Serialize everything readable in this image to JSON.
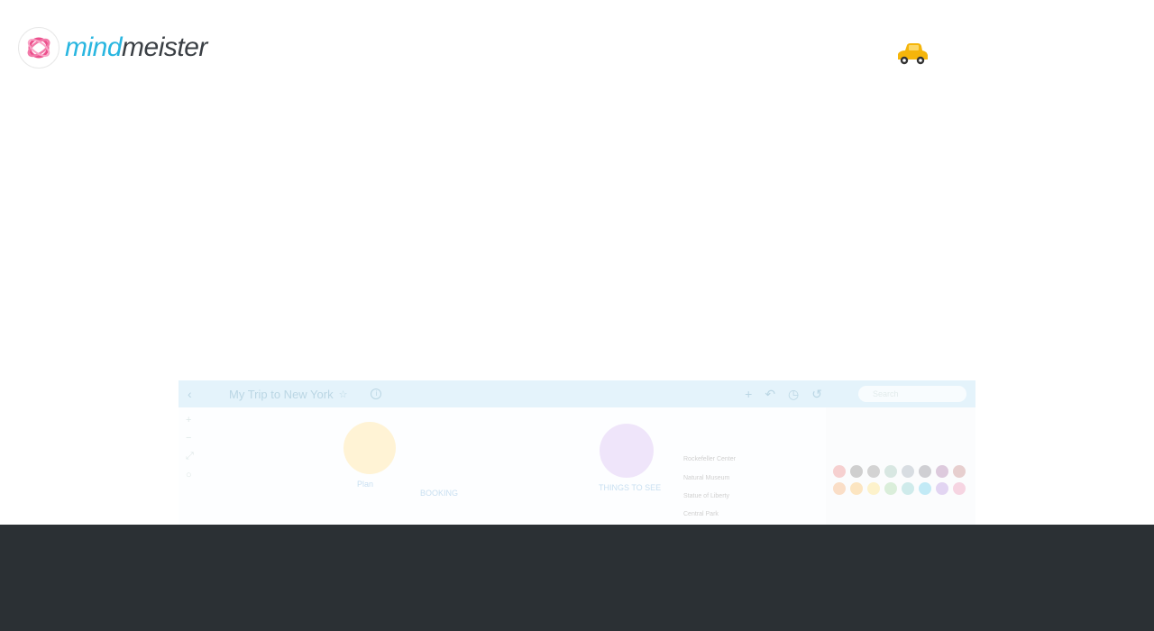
{
  "brand": {
    "name_part1": "mind",
    "name_part2": "meister"
  },
  "icons": {
    "logo": "mindmeister-logo-icon",
    "car": "taxi-car-icon"
  },
  "preview": {
    "title": "My Trip to New York",
    "star": "☆",
    "back": "‹",
    "info": "i",
    "search_placeholder": "Search",
    "tools": [
      "+",
      "↶",
      "◷",
      "↺"
    ],
    "left_tools": [
      "+",
      "−",
      "⤢",
      "○"
    ],
    "nodes": {
      "plan_label": "Plan",
      "booking_label": "BOOKING",
      "things_label": "THINGS TO SEE"
    },
    "tasks": [
      "Rockefeller Center",
      "Natural Museum",
      "Statue of Liberty",
      "Central Park"
    ]
  },
  "colors": {
    "brand_blue": "#29b6e0",
    "brand_dark": "#3a3f44",
    "footer": "#2b3034",
    "car": "#f5b50a"
  }
}
